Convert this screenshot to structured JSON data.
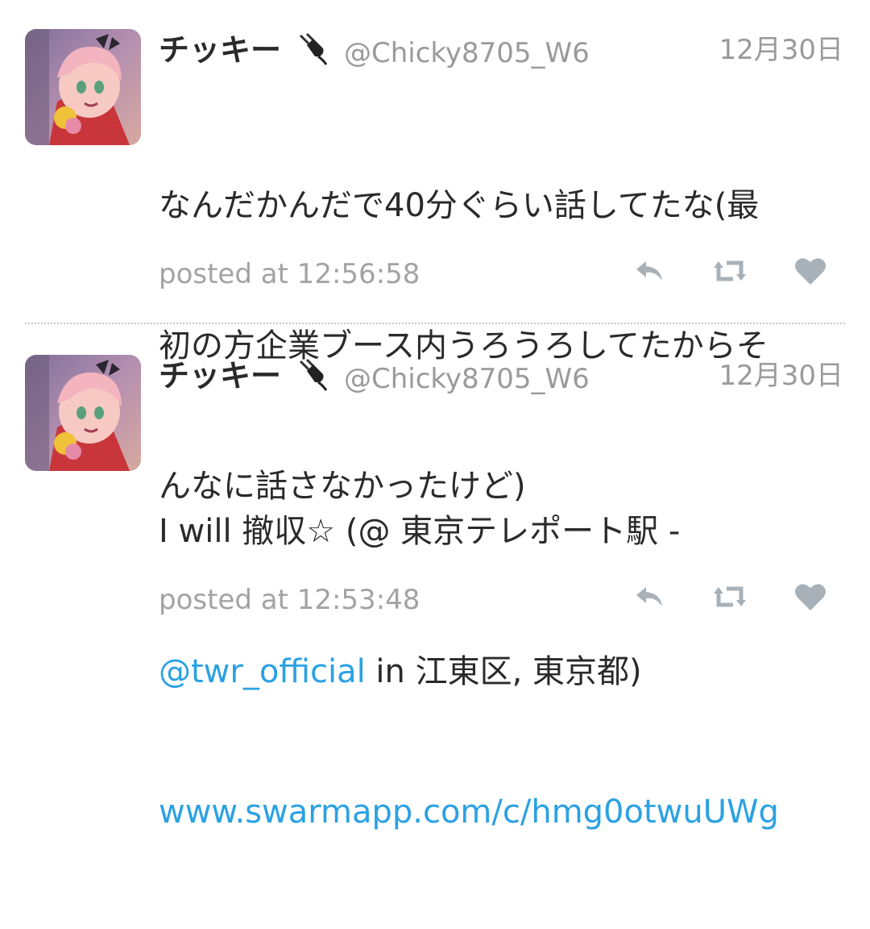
{
  "tweets": [
    {
      "display_name": "チッキー",
      "handle": "@Chicky8705_W6",
      "date": "12月30日",
      "text_lines": [
        "なんだかんだで40分ぐらい話してたな(最",
        "初の方企業ブース内うろうろしてたからそ",
        "んなに話さなかったけど)"
      ],
      "posted": "posted at 12:56:58",
      "icons": [
        "plug-icon",
        "reply-icon",
        "retweet-icon",
        "like-icon"
      ]
    },
    {
      "display_name": "チッキー",
      "handle": "@Chicky8705_W6",
      "date": "12月30日",
      "text_line_1": "I will 撤収☆ (@ 東京テレポート駅 -",
      "mention": "@twr_official",
      "text_line_2_rest": " in 江東区, 東京都)",
      "link": "www.swarmapp.com/c/hmg0otwuUWg",
      "posted": "posted at 12:53:48",
      "icons": [
        "plug-icon",
        "reply-icon",
        "retweet-icon",
        "like-icon"
      ]
    }
  ],
  "colors": {
    "link": "#2ba1e3",
    "secondary_text": "#9a9a9a",
    "icon": "#a9b1b8",
    "divider": "#c6c6c6"
  }
}
